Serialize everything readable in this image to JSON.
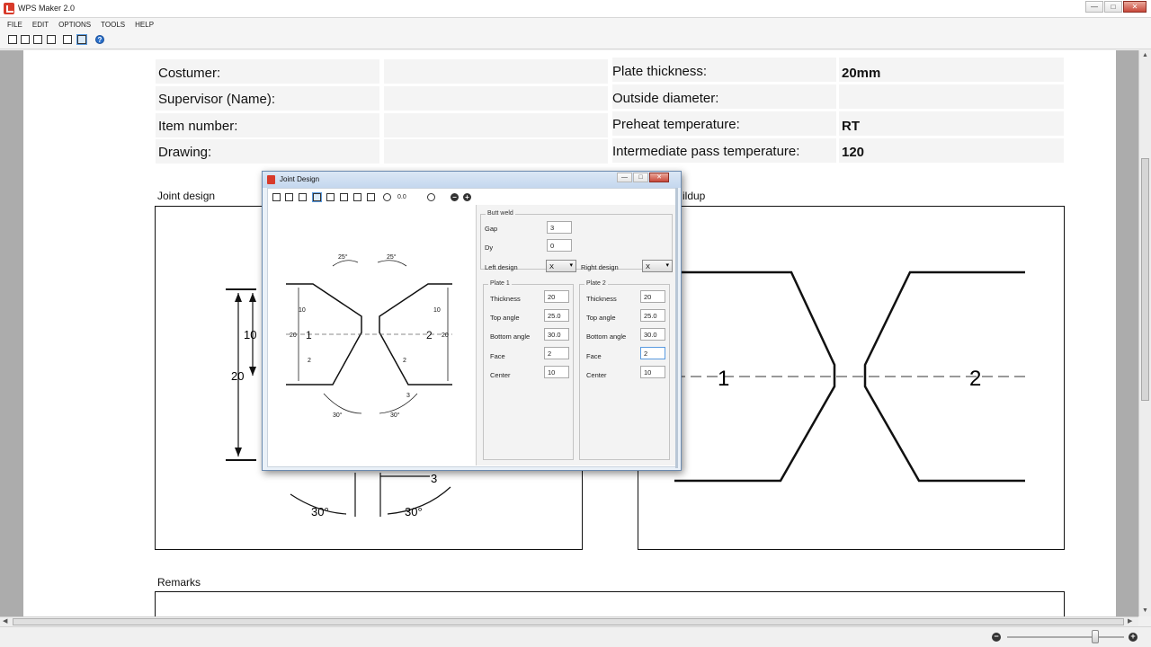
{
  "window": {
    "title": "WPS Maker 2.0",
    "buttons": {
      "minimize": "—",
      "maximize": "□",
      "close": "✕"
    }
  },
  "menu": [
    "FILE",
    "EDIT",
    "OPTIONS",
    "TOOLS",
    "HELP"
  ],
  "toolbar_icons": [
    "new-icon",
    "open-icon",
    "save-icon",
    "print-icon",
    "crop-icon",
    "view-icon",
    "help-icon"
  ],
  "document": {
    "header_rows": [
      {
        "left_label": "Costumer:",
        "left_value": "",
        "right_label": "Plate thickness:",
        "right_value": "20mm"
      },
      {
        "left_label": "Supervisor (Name):",
        "left_value": "",
        "right_label": "Outside diameter:",
        "right_value": ""
      },
      {
        "left_label": "Item number:",
        "left_value": "",
        "right_label": "Preheat temperature:",
        "right_value": "RT"
      },
      {
        "left_label": "Drawing:",
        "left_value": "",
        "right_label": "Intermediate pass temperature:",
        "right_value": "120"
      }
    ],
    "joint_design_label": "Joint design",
    "buildup_label": "ildup",
    "remarks_label": "Remarks",
    "left_drawing": {
      "dim_10": "10",
      "dim_20": "20",
      "dim_3": "3",
      "angle_left": "30°",
      "angle_right": "30°"
    },
    "right_drawing": {
      "plate1_label": "1",
      "plate2_label": "2"
    }
  },
  "dialog": {
    "title": "Joint Design",
    "rotation_value": "0.0",
    "preview": {
      "top_angle_left": "25°",
      "top_angle_right": "25°",
      "bottom_angle_left": "30°",
      "bottom_angle_right": "30°",
      "thickness_left": "20",
      "thickness_right": "20",
      "center_left": "10",
      "center_right": "10",
      "face_left": "2",
      "face_right": "2",
      "gap": "3",
      "plate1": "1",
      "plate2": "2"
    },
    "butt_weld": {
      "title": "Butt weld",
      "gap_label": "Gap",
      "gap_value": "3",
      "dy_label": "Dy",
      "dy_value": "0",
      "left_design_label": "Left design",
      "left_design_value": "X",
      "right_design_label": "Right design",
      "right_design_value": "X"
    },
    "plate1": {
      "title": "Plate 1",
      "thickness_label": "Thickness",
      "thickness": "20",
      "top_angle_label": "Top angle",
      "top_angle": "25.0",
      "bottom_angle_label": "Bottom angle",
      "bottom_angle": "30.0",
      "face_label": "Face",
      "face": "2",
      "center_label": "Center",
      "center": "10"
    },
    "plate2": {
      "title": "Plate 2",
      "thickness_label": "Thickness",
      "thickness": "20",
      "top_angle_label": "Top angle",
      "top_angle": "25.0",
      "bottom_angle_label": "Bottom angle",
      "bottom_angle": "30.0",
      "face_label": "Face",
      "face": "2",
      "center_label": "Center",
      "center": "10"
    }
  },
  "status": {
    "zoom_minus": "−",
    "zoom_plus": "+",
    "zoom_level": 0.75
  }
}
